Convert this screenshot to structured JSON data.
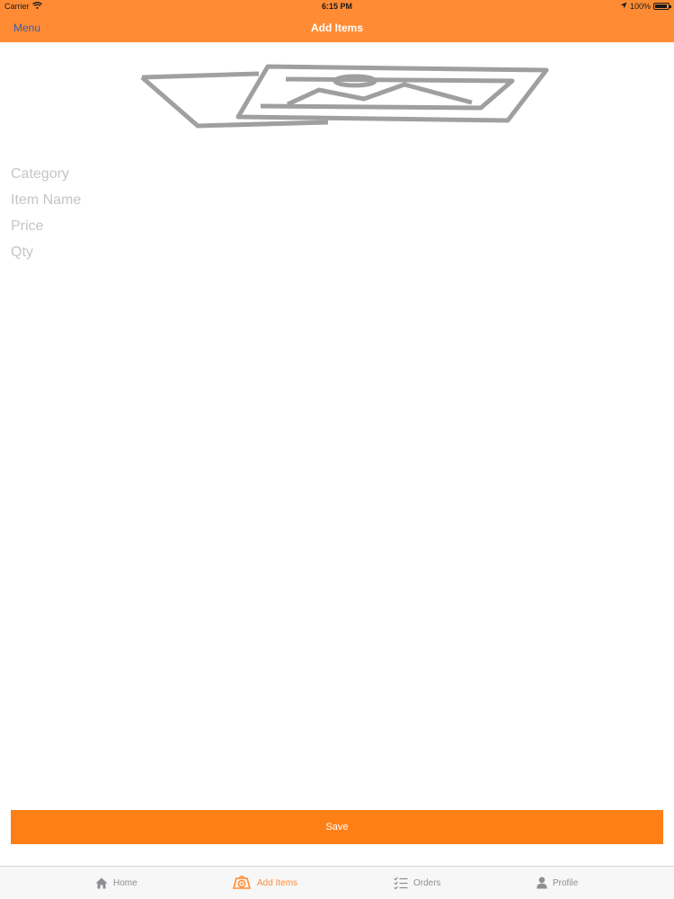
{
  "status_bar": {
    "carrier": "Carrier",
    "time": "6:15 PM",
    "battery": "100%"
  },
  "nav_bar": {
    "menu_label": "Menu",
    "title": "Add Items"
  },
  "form": {
    "category_placeholder": "Category",
    "item_name_placeholder": "Item Name",
    "price_placeholder": "Price",
    "qty_placeholder": "Qty",
    "save_label": "Save"
  },
  "tab_bar": {
    "tabs": [
      {
        "label": "Home",
        "icon": "home-icon",
        "active": false
      },
      {
        "label": "Add Items",
        "icon": "add-items-icon",
        "active": true
      },
      {
        "label": "Orders",
        "icon": "orders-checklist-icon",
        "active": false
      },
      {
        "label": "Profile",
        "icon": "profile-icon",
        "active": false
      }
    ]
  },
  "colors": {
    "brand_orange": "#FF8C34",
    "button_orange": "#FF7F17",
    "menu_link": "#3b5ba9",
    "placeholder_gray": "#c5c5c9",
    "inactive_tab": "#8e8e93"
  }
}
